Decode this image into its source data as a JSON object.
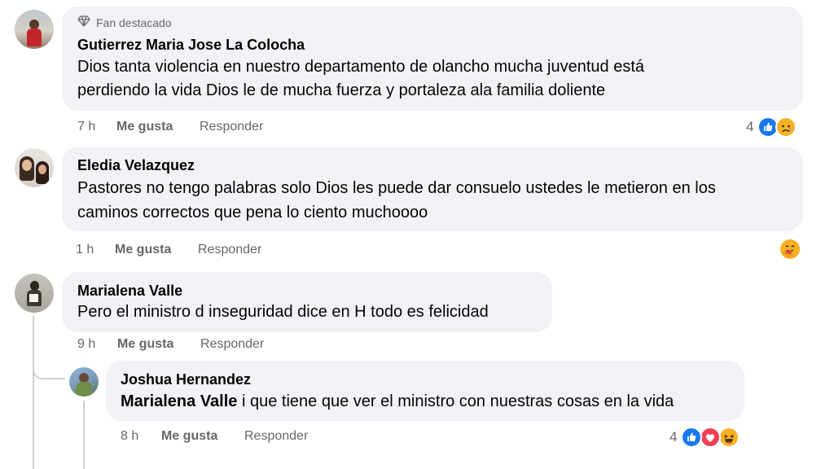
{
  "comments": [
    {
      "badge": "Fan destacado",
      "author": "Gutierrez Maria Jose La Colocha",
      "lines": [
        "Dios tanta violencia en nuestro departamento de olancho mucha juventud está",
        "perdiendo la vida Dios le de mucha fuerza y portaleza ala familia doliente"
      ],
      "time": "7 h",
      "like": "Me gusta",
      "reply": "Responder",
      "reaction_count": "4",
      "reactions": [
        "like-icon",
        "sad-icon"
      ]
    },
    {
      "author": "Eledia Velazquez",
      "lines": [
        "Pastores no tengo palabras solo Dios les puede dar consuelo ustedes le metieron en los",
        "caminos correctos que pena lo ciento muchoooo"
      ],
      "time": "1 h",
      "like": "Me gusta",
      "reply": "Responder",
      "reactions": [
        "care-icon"
      ]
    },
    {
      "author": "Marialena Valle",
      "lines": [
        "Pero el ministro d inseguridad dice en H todo es felicidad"
      ],
      "time": "9 h",
      "like": "Me gusta",
      "reply": "Responder"
    },
    {
      "author": "Joshua Hernandez",
      "mention": "Marialena Valle",
      "text": " i que tiene que ver el ministro con nuestras cosas en la vida",
      "time": "8 h",
      "like": "Me gusta",
      "reply": "Responder",
      "reaction_count": "4",
      "reactions": [
        "like-icon",
        "love-icon",
        "haha-icon"
      ]
    }
  ],
  "colors": {
    "bubble": "#f0f2f5",
    "meta": "#65676b",
    "like_blue": "#1877f2",
    "love_red": "#f33e58",
    "emoji_yellow": "#f7b125"
  }
}
